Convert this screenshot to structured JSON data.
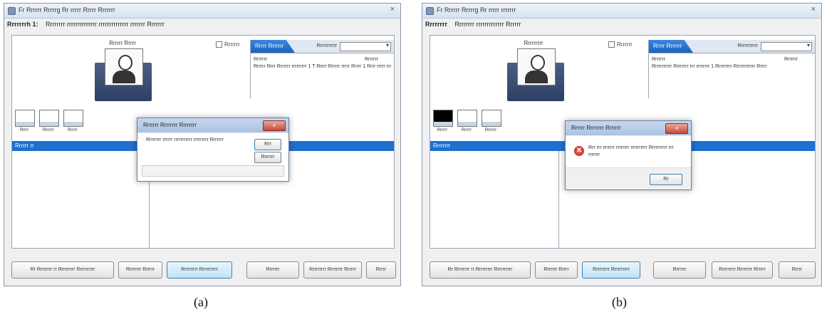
{
  "panels": {
    "a": {
      "caption": "(a)",
      "window_title": "Fr Rrrrrr Rrrrrg Rr rrrrr Rrrrr Rrrrrrr",
      "toolbar_label": "Rrrrrrrh 1:",
      "toolbar_text": "Rrrrrrrr rrrrrrrrrrrrrr rrrrrrrrrrrrrr rrrrrrr Rrrrrrr",
      "photo_caption": "Rrrrrr Rrrrr",
      "checkbox_label": "Rrrrrrr",
      "thumb_labels": [
        "Rrrrr",
        "Rrrrrrr",
        "Rrrrrr"
      ],
      "left_list_header": "Rrrrrr rr",
      "right_tab": "Rrrrr Rrrrrrr",
      "right_select_label": "Rrrrrrrrrrr",
      "right_col1": "Rrrrrrr",
      "right_col2": "Rrrrrrr",
      "right_row": "Rrrrrr Rrrr Rrrrrrr rrrrrrrrr 1 T Rrrrr  Rrrrrr rrrrr  Rrrrr 1 Rrrr rrrrr rrr",
      "dialog": {
        "title": "Rrrrrrr Rrrrrrrr Rrrrrrrr",
        "message": "Rrrrrrrr rrrrrr rrrrrrrrrrr rrrrrrrrr Rrrrrrr",
        "btn1": "Rrr",
        "btn2": "Rrrrrrr"
      },
      "buttons": [
        "Rr Rrrrrrrr rr Rrrrrrrrr Rrrrrrrrrr",
        "Rrrrrrrr Rrrrrr",
        "Rrrrrrrrr Rrrrrrrrrr",
        "Rrrrrrr",
        "Rrrrrrrrr Rrrrrrrr Rrrrrr",
        "Rrrrr"
      ]
    },
    "b": {
      "caption": "(b)",
      "window_title": "Fr Rrrrrr Rrrrrg Rr rrrrr rrrrrrr",
      "toolbar_label": "Rrrrrrrr",
      "toolbar_text": "Rrrrrrrr rrrrrrrrrrrrr Rrrrrr",
      "photo_caption": "Rrrrrrrrr",
      "checkbox_label": "Rrrrrrr",
      "thumb_labels": [
        "Rrrrrr",
        "Rrrrrr",
        "Rrrrrrr"
      ],
      "left_list_header": "Rrrrrrrr",
      "right_tab": "Rrrrr Rrrrrrr",
      "right_select_label": "Rrrrrrrrrrr",
      "right_col1": "Rrrrrrr",
      "right_col2": "Rrrrrrr",
      "right_row": "Rrrrrrrrrrr Rrrrrrrr rrr rrrrrrrr 1 Rrrrrrrrr Rrrrrrrrrrrr Rrrrr",
      "dialog": {
        "title": "Rrrrrr Rrrrrrrr Rrrrrrr",
        "message": "Rrr rrr rrrrrrr rrrrrrrr rrrrrrrrrr Rrrrrrrrrr rrr rrrrrrr",
        "btn1": "Rr"
      },
      "buttons": [
        "Rr Rrrrrrrr rr Rrrrrrrrr Rrrrrrrrrr",
        "Rrrrrrr Rrrrr",
        "Rrrrrrrrr Rrrrrrrrrr",
        "Rrrrrrr",
        "Rrrrrrrrr Rrrrrrrr Rrrrrr",
        "Rrrrr"
      ]
    }
  },
  "colors": {
    "accent_blue": "#1e6fd0",
    "window_bg": "#f0f0f0",
    "dialog_close_red": "#c5493a",
    "error_icon_red": "#c01a10"
  },
  "icons": {
    "app": "app-icon",
    "error": "error-icon",
    "close": "close-icon"
  }
}
